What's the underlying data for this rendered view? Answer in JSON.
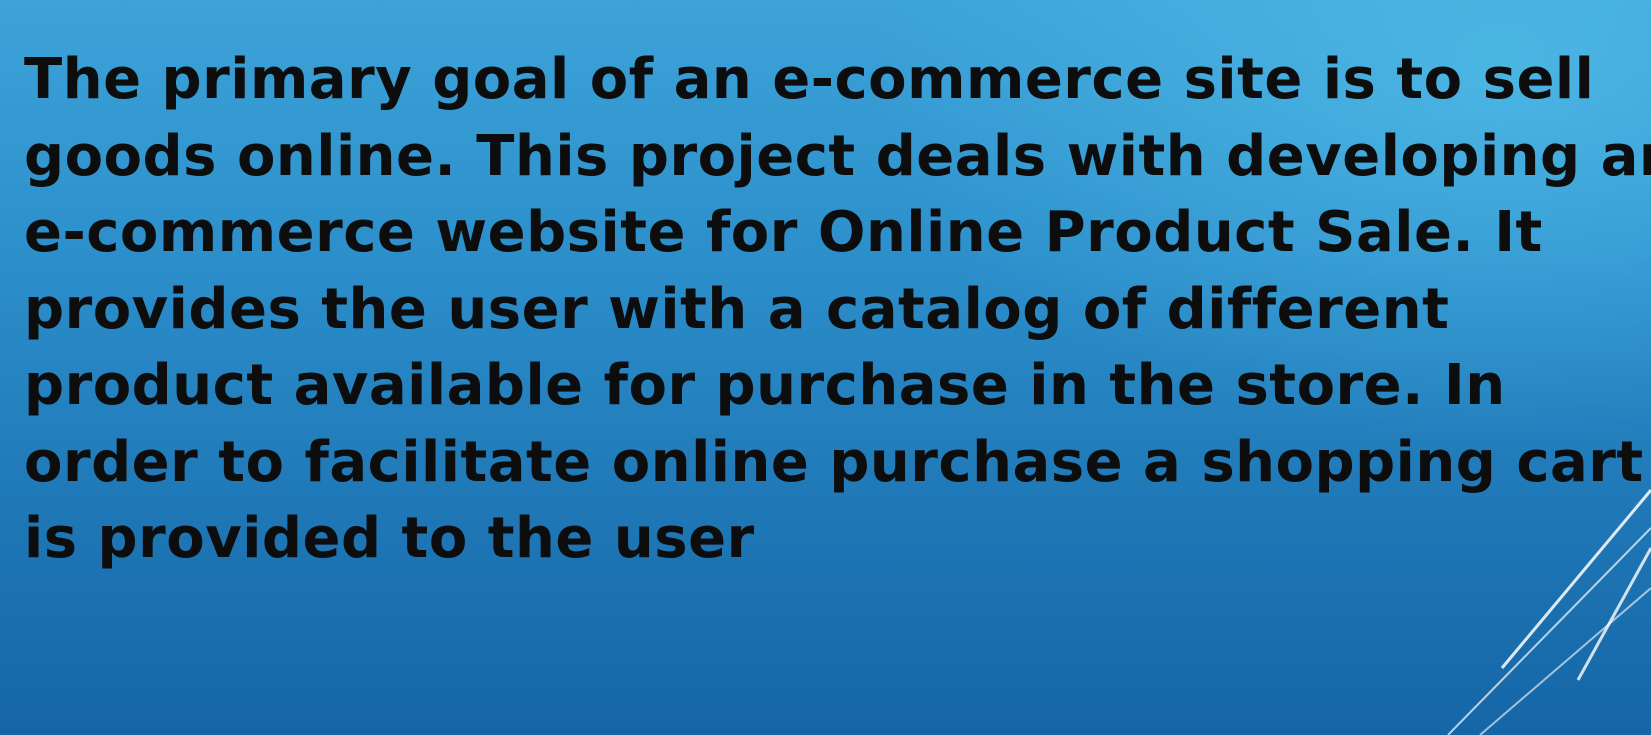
{
  "slide": {
    "body_lines": [
      "The primary goal of an e-commerce site is to sell",
      "goods online. This project deals with developing an",
      "e-commerce website for Online Product Sale. It",
      "provides the user with a catalog of different",
      "product available for purchase in the store. In",
      "order to facilitate online purchase a shopping cart",
      "is provided to the user"
    ]
  },
  "colors": {
    "background_top": "#3da3d8",
    "background_bottom": "#1566a6",
    "text": "#0d0d0d",
    "decoration": "#ffffff"
  }
}
